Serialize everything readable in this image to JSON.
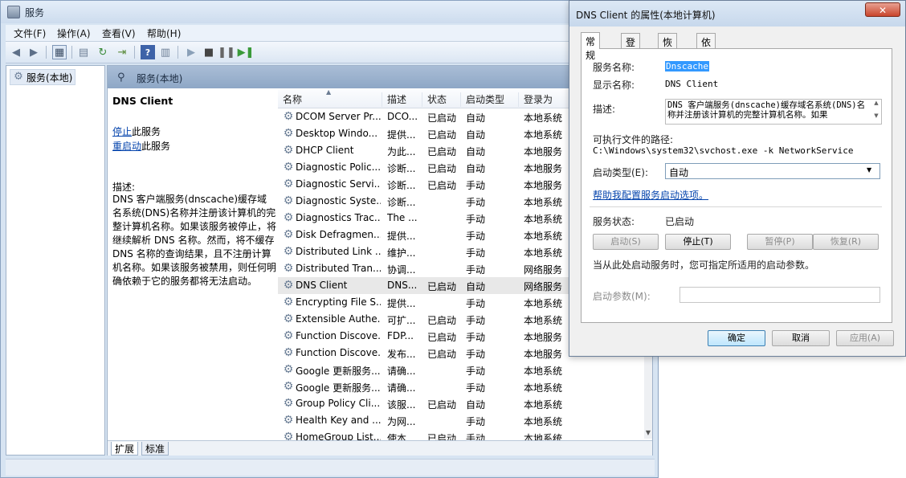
{
  "main_window": {
    "title": "服务",
    "menu": [
      "文件(F)",
      "操作(A)",
      "查看(V)",
      "帮助(H)"
    ],
    "tree_item": "服务(本地)",
    "content_header": "服务(本地)",
    "selected_service_title": "DNS Client",
    "stop_link": "停止",
    "stop_suffix": "此服务",
    "restart_link": "重启动",
    "restart_suffix": "此服务",
    "description_label": "描述:",
    "description_text": "DNS 客户端服务(dnscache)缓存域名系统(DNS)名称并注册该计算机的完整计算机名称。如果该服务被停止，将继续解析 DNS 名称。然而，将不缓存 DNS 名称的查询结果，且不注册计算机名称。如果该服务被禁用，则任何明确依赖于它的服务都将无法启动。",
    "bottom_tabs": [
      "扩展",
      "标准"
    ]
  },
  "list": {
    "columns": [
      "名称",
      "描述",
      "状态",
      "启动类型",
      "登录为"
    ],
    "rows": [
      {
        "name": "DCOM Server Pr...",
        "desc": "DCO...",
        "status": "已启动",
        "startup": "自动",
        "logon": "本地系统"
      },
      {
        "name": "Desktop Windo...",
        "desc": "提供...",
        "status": "已启动",
        "startup": "自动",
        "logon": "本地系统"
      },
      {
        "name": "DHCP Client",
        "desc": "为此...",
        "status": "已启动",
        "startup": "自动",
        "logon": "本地服务"
      },
      {
        "name": "Diagnostic Polic...",
        "desc": "诊断...",
        "status": "已启动",
        "startup": "自动",
        "logon": "本地服务"
      },
      {
        "name": "Diagnostic Servi...",
        "desc": "诊断...",
        "status": "已启动",
        "startup": "手动",
        "logon": "本地服务"
      },
      {
        "name": "Diagnostic Syste...",
        "desc": "诊断...",
        "status": "",
        "startup": "手动",
        "logon": "本地系统"
      },
      {
        "name": "Diagnostics Trac...",
        "desc": "The ...",
        "status": "",
        "startup": "手动",
        "logon": "本地系统"
      },
      {
        "name": "Disk Defragmen...",
        "desc": "提供...",
        "status": "",
        "startup": "手动",
        "logon": "本地系统"
      },
      {
        "name": "Distributed Link ...",
        "desc": "维护...",
        "status": "",
        "startup": "手动",
        "logon": "本地系统"
      },
      {
        "name": "Distributed Tran...",
        "desc": "协调...",
        "status": "",
        "startup": "手动",
        "logon": "网络服务"
      },
      {
        "name": "DNS Client",
        "desc": "DNS...",
        "status": "已启动",
        "startup": "自动",
        "logon": "网络服务"
      },
      {
        "name": "Encrypting File S...",
        "desc": "提供...",
        "status": "",
        "startup": "手动",
        "logon": "本地系统"
      },
      {
        "name": "Extensible Authe...",
        "desc": "可扩...",
        "status": "已启动",
        "startup": "手动",
        "logon": "本地系统"
      },
      {
        "name": "Function Discove...",
        "desc": "FDP...",
        "status": "已启动",
        "startup": "手动",
        "logon": "本地服务"
      },
      {
        "name": "Function Discove...",
        "desc": "发布...",
        "status": "已启动",
        "startup": "手动",
        "logon": "本地服务"
      },
      {
        "name": "Google 更新服务...",
        "desc": "请确...",
        "status": "",
        "startup": "手动",
        "logon": "本地系统"
      },
      {
        "name": "Google 更新服务...",
        "desc": "请确...",
        "status": "",
        "startup": "手动",
        "logon": "本地系统"
      },
      {
        "name": "Group Policy Cli...",
        "desc": "该服...",
        "status": "已启动",
        "startup": "自动",
        "logon": "本地系统"
      },
      {
        "name": "Health Key and ...",
        "desc": "为网...",
        "status": "",
        "startup": "手动",
        "logon": "本地系统"
      },
      {
        "name": "HomeGroup List...",
        "desc": "使本...",
        "status": "已启动",
        "startup": "手动",
        "logon": "本地系统"
      }
    ]
  },
  "dialog": {
    "title": "DNS Client 的属性(本地计算机)",
    "close": "✕",
    "tabs": [
      "常规",
      "登录",
      "恢复",
      "依存关系"
    ],
    "service_name_label": "服务名称:",
    "service_name": "Dnscache",
    "display_name_label": "显示名称:",
    "display_name": "DNS Client",
    "description_label": "描述:",
    "description": "DNS 客户端服务(dnscache)缓存域名系统(DNS)名称并注册该计算机的完整计算机名称。如果",
    "path_label": "可执行文件的路径:",
    "path": "C:\\Windows\\system32\\svchost.exe -k NetworkService",
    "startup_label": "启动类型(E):",
    "startup_value": "自动",
    "help_link": "帮助我配置服务启动选项。",
    "status_label": "服务状态:",
    "status_value": "已启动",
    "btn_start": "启动(S)",
    "btn_stop": "停止(T)",
    "btn_pause": "暂停(P)",
    "btn_resume": "恢复(R)",
    "hint": "当从此处启动服务时，您可指定所适用的启动参数。",
    "param_label": "启动参数(M):",
    "ok": "确定",
    "cancel": "取消",
    "apply": "应用(A)"
  }
}
